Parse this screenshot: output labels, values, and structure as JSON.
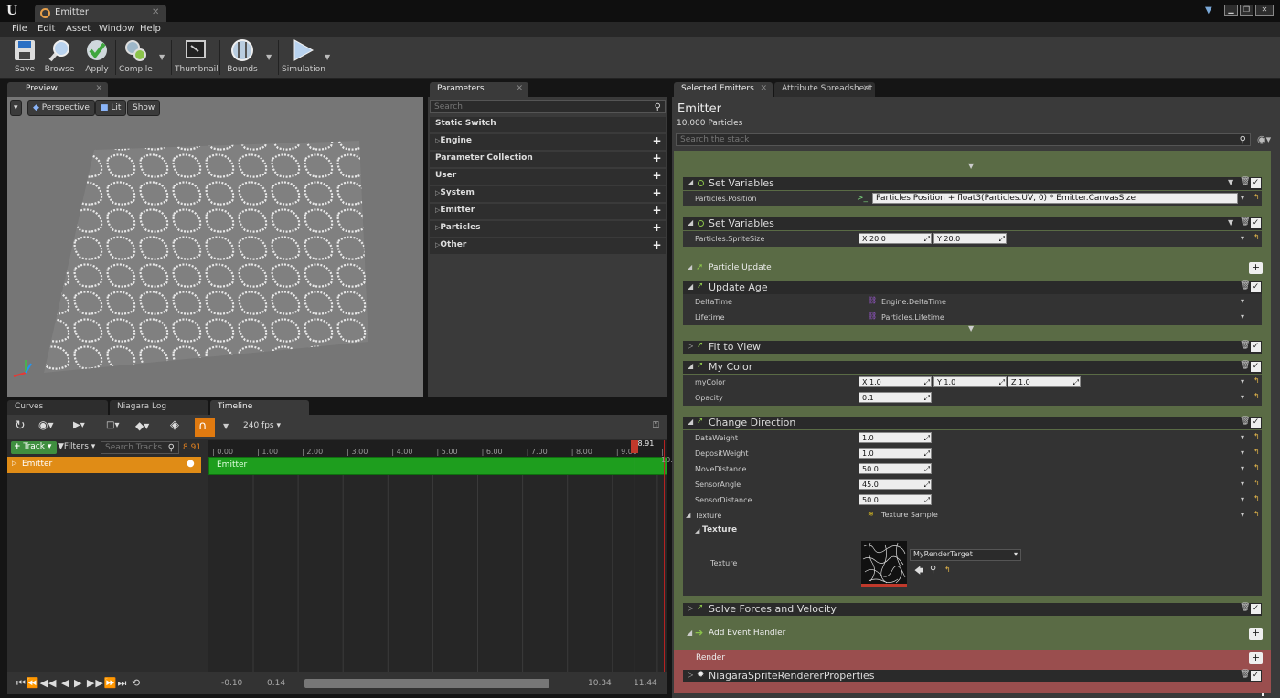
{
  "app": {
    "logo": "U",
    "doc_tab": "Emitter"
  },
  "window": {
    "min": "▁",
    "max": "❐",
    "close": "✕"
  },
  "menu": [
    "File",
    "Edit",
    "Asset",
    "Window",
    "Help"
  ],
  "toolbar": {
    "save": "Save",
    "browse": "Browse",
    "apply": "Apply",
    "compile": "Compile",
    "thumbnail": "Thumbnail",
    "bounds": "Bounds",
    "simulation": "Simulation"
  },
  "preview": {
    "tab": "Preview",
    "perspective": "Perspective",
    "lit": "Lit",
    "show": "Show"
  },
  "parameters": {
    "tab": "Parameters",
    "search_placeholder": "Search",
    "rows": [
      "Static Switch",
      "Engine",
      "Parameter Collection",
      "User",
      "System",
      "Emitter",
      "Particles",
      "Other"
    ]
  },
  "timeline": {
    "tabs": [
      "Curves",
      "Niagara Log",
      "Timeline"
    ],
    "fps": "240 fps",
    "track": "Track",
    "filters": "Filters",
    "search_placeholder": "Search Tracks",
    "time": "8.91",
    "playhead": "8.91",
    "track_name": "Emitter",
    "bar_label": "Emitter",
    "ticks": [
      "0.00",
      "1.00",
      "2.00",
      "3.00",
      "4.00",
      "5.00",
      "6.00",
      "7.00",
      "8.00",
      "9.00",
      "10.0"
    ],
    "range": {
      "start": "-0.10",
      "in": "0.14",
      "out": "10.34",
      "end": "11.44"
    }
  },
  "selected": {
    "tabs": [
      "Selected Emitters",
      "Attribute Spreadsheet"
    ],
    "title": "Emitter",
    "count": "10,000 Particles",
    "search_placeholder": "Search the stack"
  },
  "stack": {
    "set_vars_1": {
      "title": "Set Variables",
      "param": "Particles.Position",
      "expr": "Particles.Position + float3(Particles.UV, 0) * Emitter.CanvasSize"
    },
    "set_vars_2": {
      "title": "Set Variables",
      "param": "Particles.SpriteSize",
      "x": "X 20.0",
      "y": "Y 20.0"
    },
    "particle_update": "Particle Update",
    "update_age": {
      "title": "Update Age",
      "p1": "DeltaTime",
      "v1": "Engine.DeltaTime",
      "p2": "Lifetime",
      "v2": "Particles.Lifetime"
    },
    "fit_to_view": "Fit to View",
    "my_color": {
      "title": "My Color",
      "p1": "myColor",
      "x": "X 1.0",
      "y": "Y 1.0",
      "z": "Z 1.0",
      "p2": "Opacity",
      "v2": "0.1"
    },
    "change_dir": {
      "title": "Change Direction",
      "params": [
        {
          "name": "DataWeight",
          "value": "1.0"
        },
        {
          "name": "DepositWeight",
          "value": "1.0"
        },
        {
          "name": "MoveDistance",
          "value": "50.0"
        },
        {
          "name": "SensorAngle",
          "value": "45.0"
        },
        {
          "name": "SensorDistance",
          "value": "50.0"
        }
      ],
      "texture": "Texture",
      "texture_value": "Texture Sample",
      "texture_sub": "Texture",
      "texture_label": "Texture",
      "render_target": "MyRenderTarget"
    },
    "solve_forces": "Solve Forces and Velocity",
    "add_event": "Add Event Handler",
    "render": "Render",
    "renderer": "NiagaraSpriteRendererProperties"
  }
}
